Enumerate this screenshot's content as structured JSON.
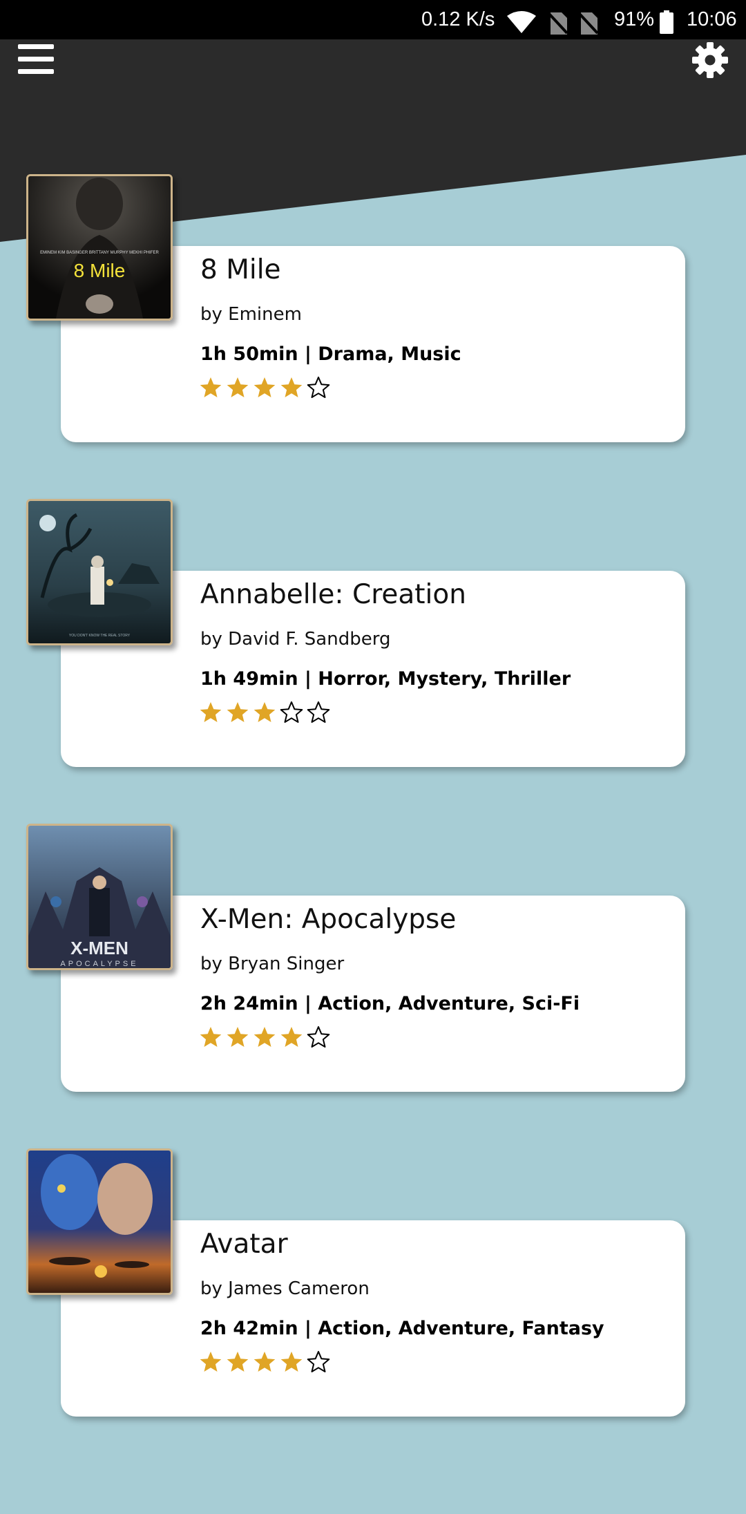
{
  "status_bar": {
    "network_speed": "0.12 K/s",
    "battery_percent": "91%",
    "time": "10:06"
  },
  "colors": {
    "header": "#2b2b2b",
    "background": "#a7cdd5",
    "card": "#ffffff",
    "star_filled": "#e0a526",
    "poster_border": "#cdb48a"
  },
  "toolbar": {
    "menu_icon": "hamburger-menu-icon",
    "settings_icon": "gear-icon"
  },
  "movies": [
    {
      "title": "8 Mile",
      "director": "by Eminem",
      "meta": "1h 50min | Drama, Music",
      "rating": 4,
      "rating_max": 5,
      "poster_text": "8 Mile"
    },
    {
      "title": "Annabelle: Creation",
      "director": "by David F. Sandberg",
      "meta": "1h 49min | Horror, Mystery, Thriller",
      "rating": 3,
      "rating_max": 5
    },
    {
      "title": "X-Men: Apocalypse",
      "director": "by Bryan Singer",
      "meta": "2h 24min | Action, Adventure, Sci-Fi",
      "rating": 4,
      "rating_max": 5,
      "poster_text": "X-MEN",
      "poster_subtext": "APOCALYPSE"
    },
    {
      "title": "Avatar",
      "director": "by James Cameron",
      "meta": "2h 42min | Action, Adventure, Fantasy",
      "rating": 4,
      "rating_max": 5
    }
  ]
}
